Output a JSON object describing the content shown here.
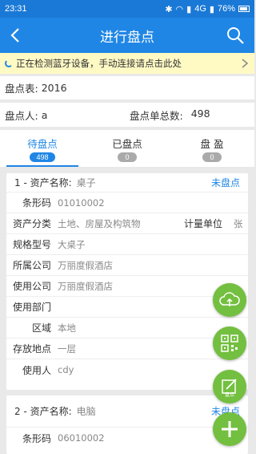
{
  "status_bar": {
    "time": "23:31",
    "network": "4G",
    "battery": "76%"
  },
  "header": {
    "title": "进行盘点"
  },
  "notice": {
    "text": "正在检测蓝牙设备，手动连接请点击此处"
  },
  "summary": {
    "sheet_label": "盘点表:",
    "sheet_value": "2016",
    "person_label": "盘点人:",
    "person_value": "a",
    "total_label": "盘点单总数:",
    "total_value": "498"
  },
  "tabs": [
    {
      "label": "待盘点",
      "count": "498"
    },
    {
      "label": "已盘点",
      "count": "0"
    },
    {
      "label": "盘 盈",
      "count": "0"
    }
  ],
  "items": [
    {
      "index_label": "1 - 资产名称:",
      "name": "桌子",
      "status": "未盘点",
      "barcode_label": "条形码",
      "barcode": "01010002",
      "category_label": "资产分类",
      "category": "土地、房屋及构筑物",
      "unit_label": "计量单位",
      "unit": "张",
      "model_label": "规格型号",
      "model": "大桌子",
      "owner_label": "所属公司",
      "owner": "万丽度假酒店",
      "user_company_label": "使用公司",
      "user_company": "万丽度假酒店",
      "dept_label": "使用部门",
      "dept": "",
      "area_label": "区域",
      "area": "本地",
      "location_label": "存放地点",
      "location": "一层",
      "user_label": "使用人",
      "user": "cdy"
    },
    {
      "index_label": "2 - 资产名称:",
      "name": "电脑",
      "status": "未盘点",
      "barcode_label": "条形码",
      "barcode": "06010002"
    }
  ],
  "fabs": {
    "inventory_label": "盘点"
  },
  "colors": {
    "primary": "#1f86e6",
    "fab_green": "#73bf3f",
    "notice_bg": "#fff9c4"
  }
}
